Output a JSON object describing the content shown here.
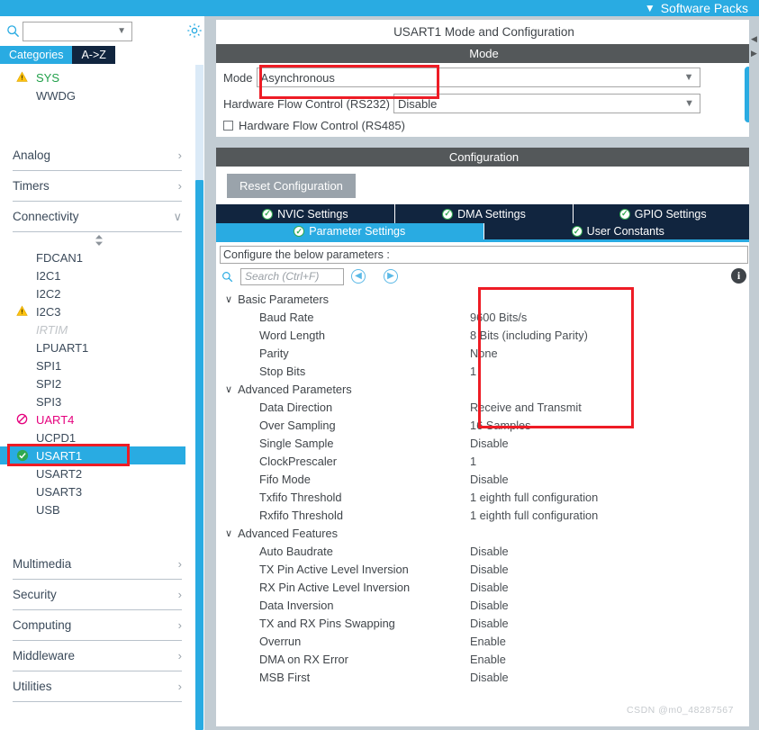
{
  "topbar": {
    "software_packs_label": "Software Packs",
    "chevron_icon": "chevron-down-icon",
    "accent_color": "#29abe2"
  },
  "sidebar": {
    "search": {
      "value": "",
      "placeholder": ""
    },
    "search_icon": "search-icon",
    "settings_icon": "gear-icon",
    "tabs": [
      {
        "label": "Categories",
        "active": true
      },
      {
        "label": "A->Z",
        "active": false
      }
    ],
    "top_items": [
      {
        "label": "SYS",
        "state": "warning",
        "badge": "warning-triangle-icon"
      },
      {
        "label": "WWDG",
        "state": "normal",
        "badge": ""
      }
    ],
    "groups": [
      {
        "label": "Analog",
        "expanded": false,
        "carat": "›"
      },
      {
        "label": "Timers",
        "expanded": false,
        "carat": "›"
      },
      {
        "label": "Connectivity",
        "expanded": true,
        "carat": "∨"
      }
    ],
    "connectivity_items": [
      {
        "label": "FDCAN1",
        "state": "normal",
        "badge": ""
      },
      {
        "label": "I2C1",
        "state": "normal",
        "badge": ""
      },
      {
        "label": "I2C2",
        "state": "normal",
        "badge": ""
      },
      {
        "label": "I2C3",
        "state": "warning",
        "badge": "warning-triangle-icon"
      },
      {
        "label": "IRTIM",
        "state": "disabled",
        "badge": ""
      },
      {
        "label": "LPUART1",
        "state": "normal",
        "badge": ""
      },
      {
        "label": "SPI1",
        "state": "normal",
        "badge": ""
      },
      {
        "label": "SPI2",
        "state": "normal",
        "badge": ""
      },
      {
        "label": "SPI3",
        "state": "normal",
        "badge": ""
      },
      {
        "label": "UART4",
        "state": "error",
        "badge": "no-entry-icon"
      },
      {
        "label": "UCPD1",
        "state": "normal",
        "badge": ""
      },
      {
        "label": "USART1",
        "state": "configured",
        "badge": "check-circle-icon",
        "selected": true
      },
      {
        "label": "USART2",
        "state": "normal",
        "badge": ""
      },
      {
        "label": "USART3",
        "state": "normal",
        "badge": ""
      },
      {
        "label": "USB",
        "state": "normal",
        "badge": ""
      }
    ],
    "bottom_groups": [
      {
        "label": "Multimedia",
        "carat": "›"
      },
      {
        "label": "Security",
        "carat": "›"
      },
      {
        "label": "Computing",
        "carat": "›"
      },
      {
        "label": "Middleware",
        "carat": "›"
      },
      {
        "label": "Utilities",
        "carat": "›"
      }
    ]
  },
  "main": {
    "panel_title": "USART1 Mode and Configuration",
    "mode_band": "Mode",
    "mode_label": "Mode",
    "mode_value": "Asynchronous",
    "hwfc232_label": "Hardware Flow Control (RS232)",
    "hwfc232_value": "Disable",
    "hwfc485_label": "Hardware Flow Control (RS485)",
    "dropdown_icon": "chevron-down-icon",
    "configuration_band": "Configuration",
    "reset_label": "Reset Configuration",
    "tabs_row1": [
      {
        "label": "NVIC Settings",
        "icon": "check-circle-icon",
        "active": false
      },
      {
        "label": "DMA Settings",
        "icon": "check-circle-icon",
        "active": false
      },
      {
        "label": "GPIO Settings",
        "icon": "check-circle-icon",
        "active": false
      }
    ],
    "tabs_row2": [
      {
        "label": "Parameter Settings",
        "icon": "check-circle-icon",
        "active": true
      },
      {
        "label": "User Constants",
        "icon": "check-circle-icon",
        "active": false
      }
    ],
    "configure_hint": "Configure the below parameters :",
    "param_search": {
      "value": "",
      "placeholder": "Search (Ctrl+F)"
    },
    "search_icon": "search-icon",
    "collapse_all_icon": "collapse-left-icon",
    "expand_all_icon": "expand-right-icon",
    "info_icon": "info-icon",
    "parameters": [
      {
        "type": "section",
        "name": "Basic Parameters",
        "value": "",
        "caret": "∨"
      },
      {
        "type": "row",
        "name": "Baud Rate",
        "value": "9600 Bits/s"
      },
      {
        "type": "row",
        "name": "Word Length",
        "value": "8 Bits (including Parity)"
      },
      {
        "type": "row",
        "name": "Parity",
        "value": "None"
      },
      {
        "type": "row",
        "name": "Stop Bits",
        "value": "1"
      },
      {
        "type": "section",
        "name": "Advanced Parameters",
        "value": "",
        "caret": "∨"
      },
      {
        "type": "row",
        "name": "Data Direction",
        "value": "Receive and Transmit"
      },
      {
        "type": "row",
        "name": "Over Sampling",
        "value": "16 Samples"
      },
      {
        "type": "row",
        "name": "Single Sample",
        "value": "Disable"
      },
      {
        "type": "row",
        "name": "ClockPrescaler",
        "value": "1"
      },
      {
        "type": "row",
        "name": "Fifo Mode",
        "value": "Disable"
      },
      {
        "type": "row",
        "name": "Txfifo Threshold",
        "value": "1 eighth full configuration"
      },
      {
        "type": "row",
        "name": "Rxfifo Threshold",
        "value": "1 eighth full configuration"
      },
      {
        "type": "section",
        "name": "Advanced Features",
        "value": "",
        "caret": "∨"
      },
      {
        "type": "row",
        "name": "Auto Baudrate",
        "value": "Disable"
      },
      {
        "type": "row",
        "name": "TX Pin Active Level Inversion",
        "value": "Disable"
      },
      {
        "type": "row",
        "name": "RX Pin Active Level Inversion",
        "value": "Disable"
      },
      {
        "type": "row",
        "name": "Data Inversion",
        "value": "Disable"
      },
      {
        "type": "row",
        "name": "TX and RX Pins Swapping",
        "value": "Disable"
      },
      {
        "type": "row",
        "name": "Overrun",
        "value": "Enable"
      },
      {
        "type": "row",
        "name": "DMA on RX Error",
        "value": "Enable"
      },
      {
        "type": "row",
        "name": "MSB First",
        "value": "Disable"
      }
    ]
  },
  "annotations": {
    "highlight_color": "#ee1c25",
    "boxes": [
      "mode-value-highlight",
      "usart1-item-highlight",
      "basic-values-highlight"
    ]
  },
  "watermark": "CSDN @m0_48287567"
}
